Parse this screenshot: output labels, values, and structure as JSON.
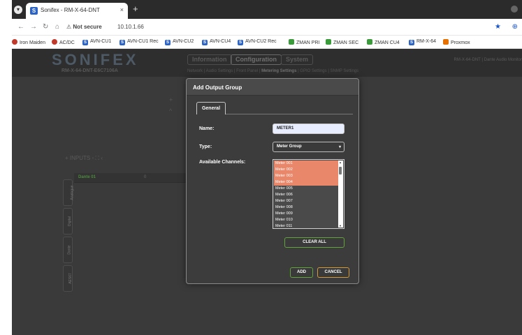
{
  "browser": {
    "tab_title": "Sonifex - RM-X-64-DNT",
    "tab_close": "×",
    "new_tab": "+",
    "security_label": "Not secure",
    "url": "10.10.1.66"
  },
  "bookmarks": [
    {
      "label": "Iron Maiden",
      "icon": "record-icon",
      "color": "#c0392b"
    },
    {
      "label": "AC/DC",
      "icon": "record-icon",
      "color": "#c0392b"
    },
    {
      "label": "AVN-CU1",
      "icon": "S",
      "color": "#2b63c6"
    },
    {
      "label": "AVN-CU1 Rec",
      "icon": "S",
      "color": "#2b63c6"
    },
    {
      "label": "AVN-CU2",
      "icon": "S",
      "color": "#2b63c6"
    },
    {
      "label": "AVN-CU4",
      "icon": "S",
      "color": "#2b63c6"
    },
    {
      "label": "AVN-CU2 Rec",
      "icon": "S",
      "color": "#2b63c6"
    },
    {
      "label": "ZMAN PRI",
      "icon": "zman-icon",
      "color": "#3a9b3a"
    },
    {
      "label": "ZMAN SEC",
      "icon": "zman-icon",
      "color": "#3a9b3a"
    },
    {
      "label": "ZMAN CU4",
      "icon": "zman-icon",
      "color": "#3a9b3a"
    },
    {
      "label": "RM-X-64",
      "icon": "S",
      "color": "#2b63c6"
    },
    {
      "label": "Proxmox",
      "icon": "proxmox-icon",
      "color": "#e57000"
    }
  ],
  "app": {
    "logo": "SONIFEX",
    "device": "RM-X-64-DNT-E6C7106A",
    "device_right": "RM-X-64-DNT | Dante Audio Monitor",
    "main_tabs": [
      "Information",
      "Configuration",
      "System"
    ],
    "subnav_before": "Network | Audio Settings | Front Panel | ",
    "subnav_active": "Metering Settings",
    "subnav_after": " | GPIO Settings | SNMP Settings",
    "inputs_label": "INPUTS",
    "side_tabs": [
      "Analogue",
      "Digital",
      "Dante",
      "AES67"
    ],
    "panel_row_label": "Dante 01",
    "panel_row_value": "0"
  },
  "modal": {
    "title": "Add Output Group",
    "tab_general": "General",
    "name_label": "Name:",
    "name_value": "METER1",
    "type_label": "Type:",
    "type_value": "Meter Group",
    "channels_label": "Available Channels:",
    "channels": [
      {
        "label": "Meter 001",
        "selected": true
      },
      {
        "label": "Meter 002",
        "selected": true
      },
      {
        "label": "Meter 003",
        "selected": true
      },
      {
        "label": "Meter 004",
        "selected": true
      },
      {
        "label": "Meter 005",
        "selected": false
      },
      {
        "label": "Meter 006",
        "selected": false
      },
      {
        "label": "Meter 007",
        "selected": false
      },
      {
        "label": "Meter 008",
        "selected": false
      },
      {
        "label": "Meter 009",
        "selected": false
      },
      {
        "label": "Meter 010",
        "selected": false
      },
      {
        "label": "Meter 011",
        "selected": false
      }
    ],
    "clear_all": "CLEAR ALL",
    "add": "ADD",
    "cancel": "CANCEL"
  },
  "colors": {
    "selected_row": "#e8876a",
    "green_border": "#62a33b",
    "orange_border": "#d49a3a"
  }
}
